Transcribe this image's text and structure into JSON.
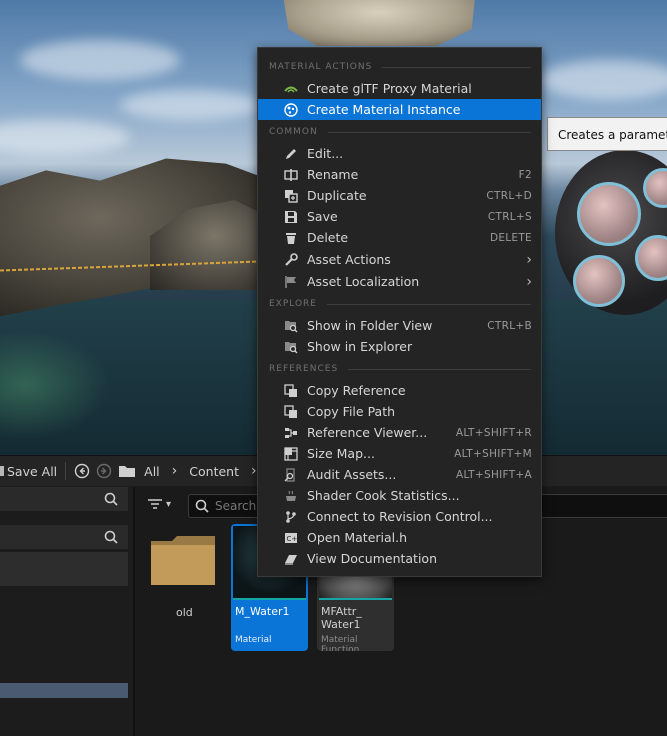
{
  "tooltip": {
    "text": "Creates a parameter"
  },
  "menu": {
    "sections": {
      "material_actions": "MATERIAL ACTIONS",
      "common": "COMMON",
      "explore": "EXPLORE",
      "references": "REFERENCES"
    },
    "items": {
      "create_gltf": {
        "label": "Create glTF Proxy Material",
        "icon": "gltf-icon"
      },
      "create_instance": {
        "label": "Create Material Instance",
        "icon": "material-instance-icon"
      },
      "edit": {
        "label": "Edit...",
        "icon": "pencil-icon"
      },
      "rename": {
        "label": "Rename",
        "shortcut": "F2",
        "icon": "rename-icon"
      },
      "duplicate": {
        "label": "Duplicate",
        "shortcut": "CTRL+D",
        "icon": "duplicate-icon"
      },
      "save": {
        "label": "Save",
        "shortcut": "CTRL+S",
        "icon": "save-icon"
      },
      "delete": {
        "label": "Delete",
        "shortcut": "DELETE",
        "icon": "trash-icon"
      },
      "asset_actions": {
        "label": "Asset Actions",
        "icon": "wrench-icon"
      },
      "asset_localization": {
        "label": "Asset Localization",
        "icon": "flag-icon"
      },
      "show_folder_view": {
        "label": "Show in Folder View",
        "shortcut": "CTRL+B",
        "icon": "folder-search-icon"
      },
      "show_explorer": {
        "label": "Show in Explorer",
        "icon": "folder-search-icon"
      },
      "copy_reference": {
        "label": "Copy Reference",
        "icon": "copy-icon"
      },
      "copy_file_path": {
        "label": "Copy File Path",
        "icon": "copy-icon"
      },
      "reference_viewer": {
        "label": "Reference Viewer...",
        "shortcut": "ALT+SHIFT+R",
        "icon": "graph-icon"
      },
      "size_map": {
        "label": "Size Map...",
        "shortcut": "ALT+SHIFT+M",
        "icon": "size-map-icon"
      },
      "audit_assets": {
        "label": "Audit Assets...",
        "shortcut": "ALT+SHIFT+A",
        "icon": "audit-icon"
      },
      "shader_cook": {
        "label": "Shader Cook Statistics...",
        "icon": "cook-icon"
      },
      "revision_control": {
        "label": "Connect to Revision Control...",
        "icon": "branch-icon"
      },
      "open_material_h": {
        "label": "Open Material.h",
        "icon": "cpp-file-icon"
      },
      "view_docs": {
        "label": "View Documentation",
        "icon": "book-icon"
      }
    }
  },
  "toolbar": {
    "save_all": "Save All",
    "breadcrumb": [
      "All",
      "Content"
    ]
  },
  "content": {
    "search_placeholder": "Search",
    "tiles": [
      {
        "name": "old",
        "type": ""
      },
      {
        "name": "M_Water1",
        "type": "Material"
      },
      {
        "name": "MFAttr_\nWater1",
        "type": "Material Function"
      }
    ]
  },
  "colors": {
    "accent": "#0a74d7",
    "menu_bg": "#242424",
    "material_underline": "#16a5a5"
  }
}
